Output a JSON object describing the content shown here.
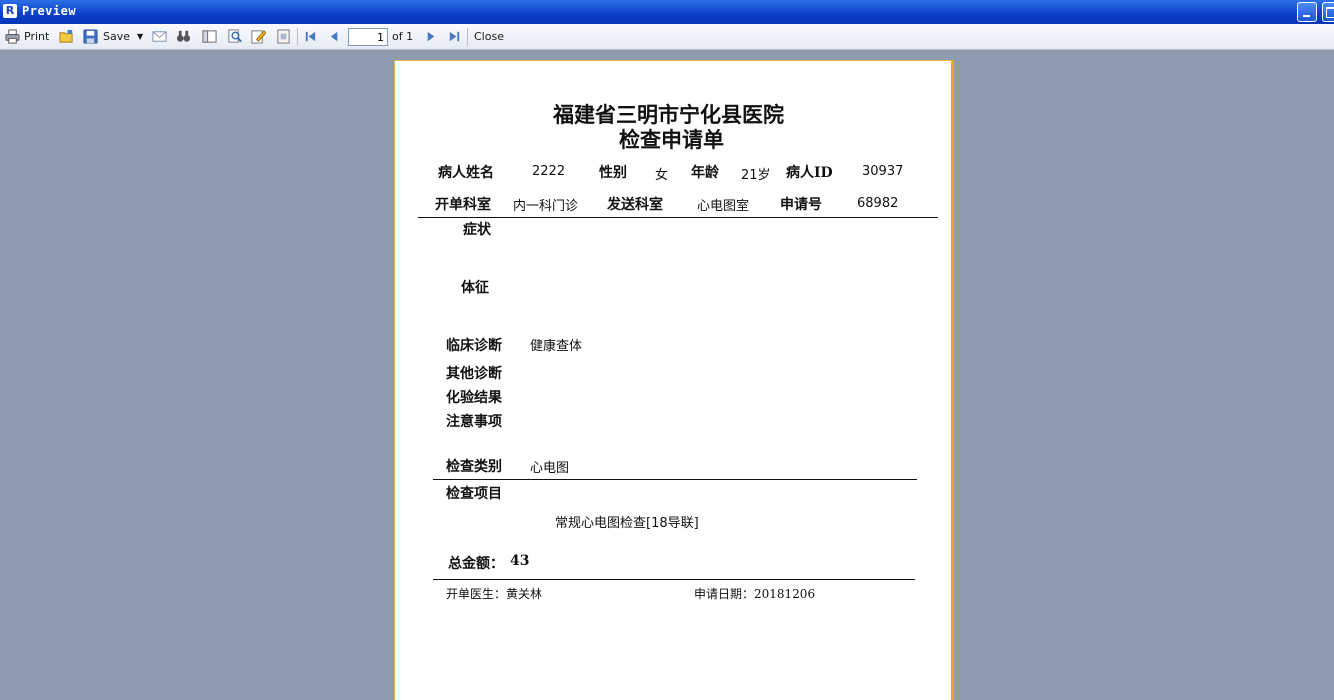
{
  "window": {
    "title": "Preview"
  },
  "toolbar": {
    "print_label": "Print",
    "save_label": "Save",
    "page_value": "1",
    "page_of": "of 1",
    "close_label": "Close"
  },
  "report": {
    "hospital": "福建省三明市宁化县医院",
    "form_title": "检查申请单",
    "patient_name_label": "病人姓名",
    "patient_name": "2222",
    "gender_label": "性别",
    "gender": "女",
    "age_label": "年龄",
    "age": "21岁",
    "patient_id_label": "病人ID",
    "patient_id": "30937",
    "dept_label": "开单科室",
    "dept": "内一科门诊",
    "send_dept_label": "发送科室",
    "send_dept": "心电图室",
    "request_no_label": "申请号",
    "request_no": "68982",
    "symptom_label": "症状",
    "sign_label": "体征",
    "clinical_dx_label": "临床诊断",
    "clinical_dx": "健康查体",
    "other_dx_label": "其他诊断",
    "lab_result_label": "化验结果",
    "notes_label": "注意事项",
    "exam_type_label": "检查类别",
    "exam_type": "心电图",
    "exam_items_label": "检查项目",
    "exam_item": "常规心电图检查[18导联]",
    "total_label": "总金额：",
    "total": "43",
    "doctor_text": "开单医生：黄关林",
    "date_text": "申请日期：20181206"
  }
}
